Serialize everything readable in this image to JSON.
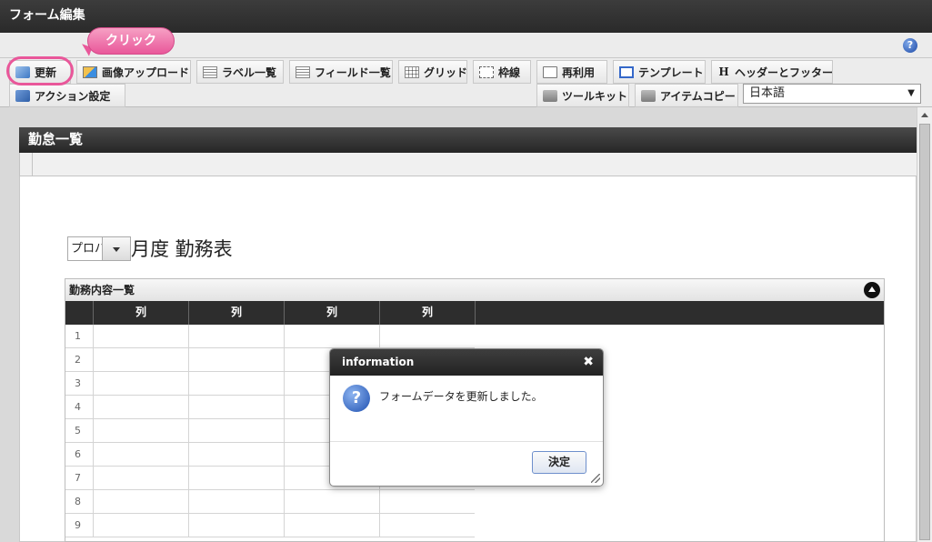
{
  "window": {
    "title": "フォーム編集"
  },
  "annotation": {
    "callout_label": "クリック"
  },
  "toolbar": {
    "row1": [
      {
        "label": "更新",
        "icon": "update-icon"
      },
      {
        "label": "画像アップロード",
        "icon": "image-upload-icon"
      },
      {
        "label": "ラベル一覧",
        "icon": "list-icon"
      },
      {
        "label": "フィールド一覧",
        "icon": "list-icon"
      },
      {
        "label": "グリッド",
        "icon": "grid-icon"
      },
      {
        "label": "枠線",
        "icon": "frame-icon"
      },
      {
        "label": "再利用",
        "icon": "reuse-icon"
      },
      {
        "label": "テンプレート",
        "icon": "template-icon"
      },
      {
        "label": "ヘッダーとフッター",
        "icon": "header-icon",
        "icon_glyph": "H"
      }
    ],
    "row2": [
      {
        "label": "アクション設定",
        "icon": "action-icon"
      },
      {
        "label": "ツールキット",
        "icon": "toolkit-icon"
      },
      {
        "label": "アイテムコピー",
        "icon": "item-copy-icon"
      }
    ],
    "language": {
      "selected": "日本語",
      "arrow": "▼"
    },
    "help_glyph": "?"
  },
  "page": {
    "header": "勤怠一覧",
    "form": {
      "year_value": "プロパ",
      "title": "月度 勤務表"
    },
    "panel": {
      "title": "勤務内容一覧",
      "columns": [
        "列",
        "列",
        "列",
        "列"
      ],
      "rows": [
        "1",
        "2",
        "3",
        "4",
        "5",
        "6",
        "7",
        "8",
        "9"
      ]
    }
  },
  "dialog": {
    "title": "information",
    "close_glyph": "✖",
    "icon_glyph": "?",
    "message": "フォームデータを更新しました。",
    "ok_label": "決定"
  },
  "colors": {
    "accent_pink": "#e9579a",
    "title_bar": "#2a2a2a",
    "help_blue": "#1c49a6"
  }
}
